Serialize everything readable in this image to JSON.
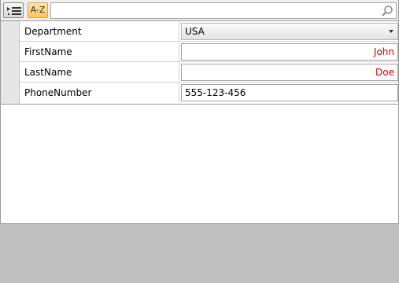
{
  "toolbar": {
    "categorized_icon": "categorized-list-icon",
    "alphabetical_label": "A-Z",
    "search_placeholder": "",
    "search_icon": "magnifier-icon"
  },
  "properties": [
    {
      "name": "Department",
      "value": "USA",
      "editor": "combo"
    },
    {
      "name": "FirstName",
      "value": "John",
      "editor": "text",
      "invalid": true
    },
    {
      "name": "LastName",
      "value": "Doe",
      "editor": "text",
      "invalid": true
    },
    {
      "name": "PhoneNumber",
      "value": "555-123-456",
      "editor": "text"
    }
  ],
  "colors": {
    "invalid_text": "#d40000",
    "selected_sort": "#ffc55a",
    "description_panel": "#c0c0c0"
  }
}
